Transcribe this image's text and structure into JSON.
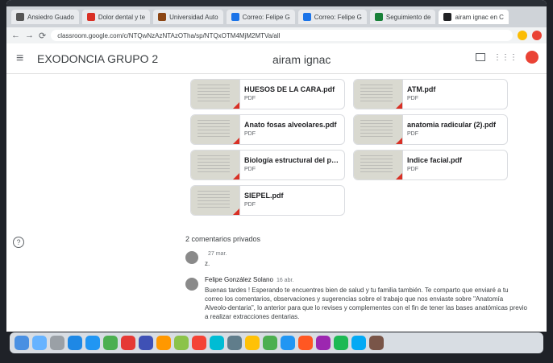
{
  "browser": {
    "tabs": [
      {
        "label": "Ansiedro Guado"
      },
      {
        "label": "Dolor dental y te"
      },
      {
        "label": "Universidad Auto"
      },
      {
        "label": "Correo: Felipe G"
      },
      {
        "label": "Correo: Felipe G"
      },
      {
        "label": "Seguimiento de"
      },
      {
        "label": "airam ignac en C"
      }
    ],
    "url": "classroom.google.com/c/NTQwNzAzNTAzOTha/sp/NTQxOTM4MjM2MTVa/all"
  },
  "app": {
    "class_title": "EXODONCIA GRUPO 2",
    "person_name": "airam ignac"
  },
  "files": [
    {
      "name": "HUESOS DE LA CARA.pdf",
      "type": "PDF"
    },
    {
      "name": "ATM.pdf",
      "type": "PDF"
    },
    {
      "name": "Anato fosas alveolares.pdf",
      "type": "PDF"
    },
    {
      "name": "anatomia radicular (2).pdf",
      "type": "PDF"
    },
    {
      "name": "Biología estructural del pe...",
      "type": "PDF"
    },
    {
      "name": "Indice facial.pdf",
      "type": "PDF"
    },
    {
      "name": "SIEPEL.pdf",
      "type": "PDF"
    }
  ],
  "comments": {
    "label": "2 comentarios privados",
    "items": [
      {
        "name": "",
        "date": "27 mar.",
        "text": "z."
      },
      {
        "name": "Felipe González Solano",
        "date": "16 abr.",
        "text": "Buenas tardes ! Esperando te encuentres bien de salud y tu familia también. Te comparto que enviaré a tu correo los comentarios, observaciones y sugerencias sobre el trabajo que nos enviaste sobre \"Anatomía Alveolo-dentaria\", lo anterior para que lo revises y complementes con el fin de tener las bases anatómicas previo a realizar extracciones dentarias."
      }
    ]
  },
  "help_label": "?"
}
